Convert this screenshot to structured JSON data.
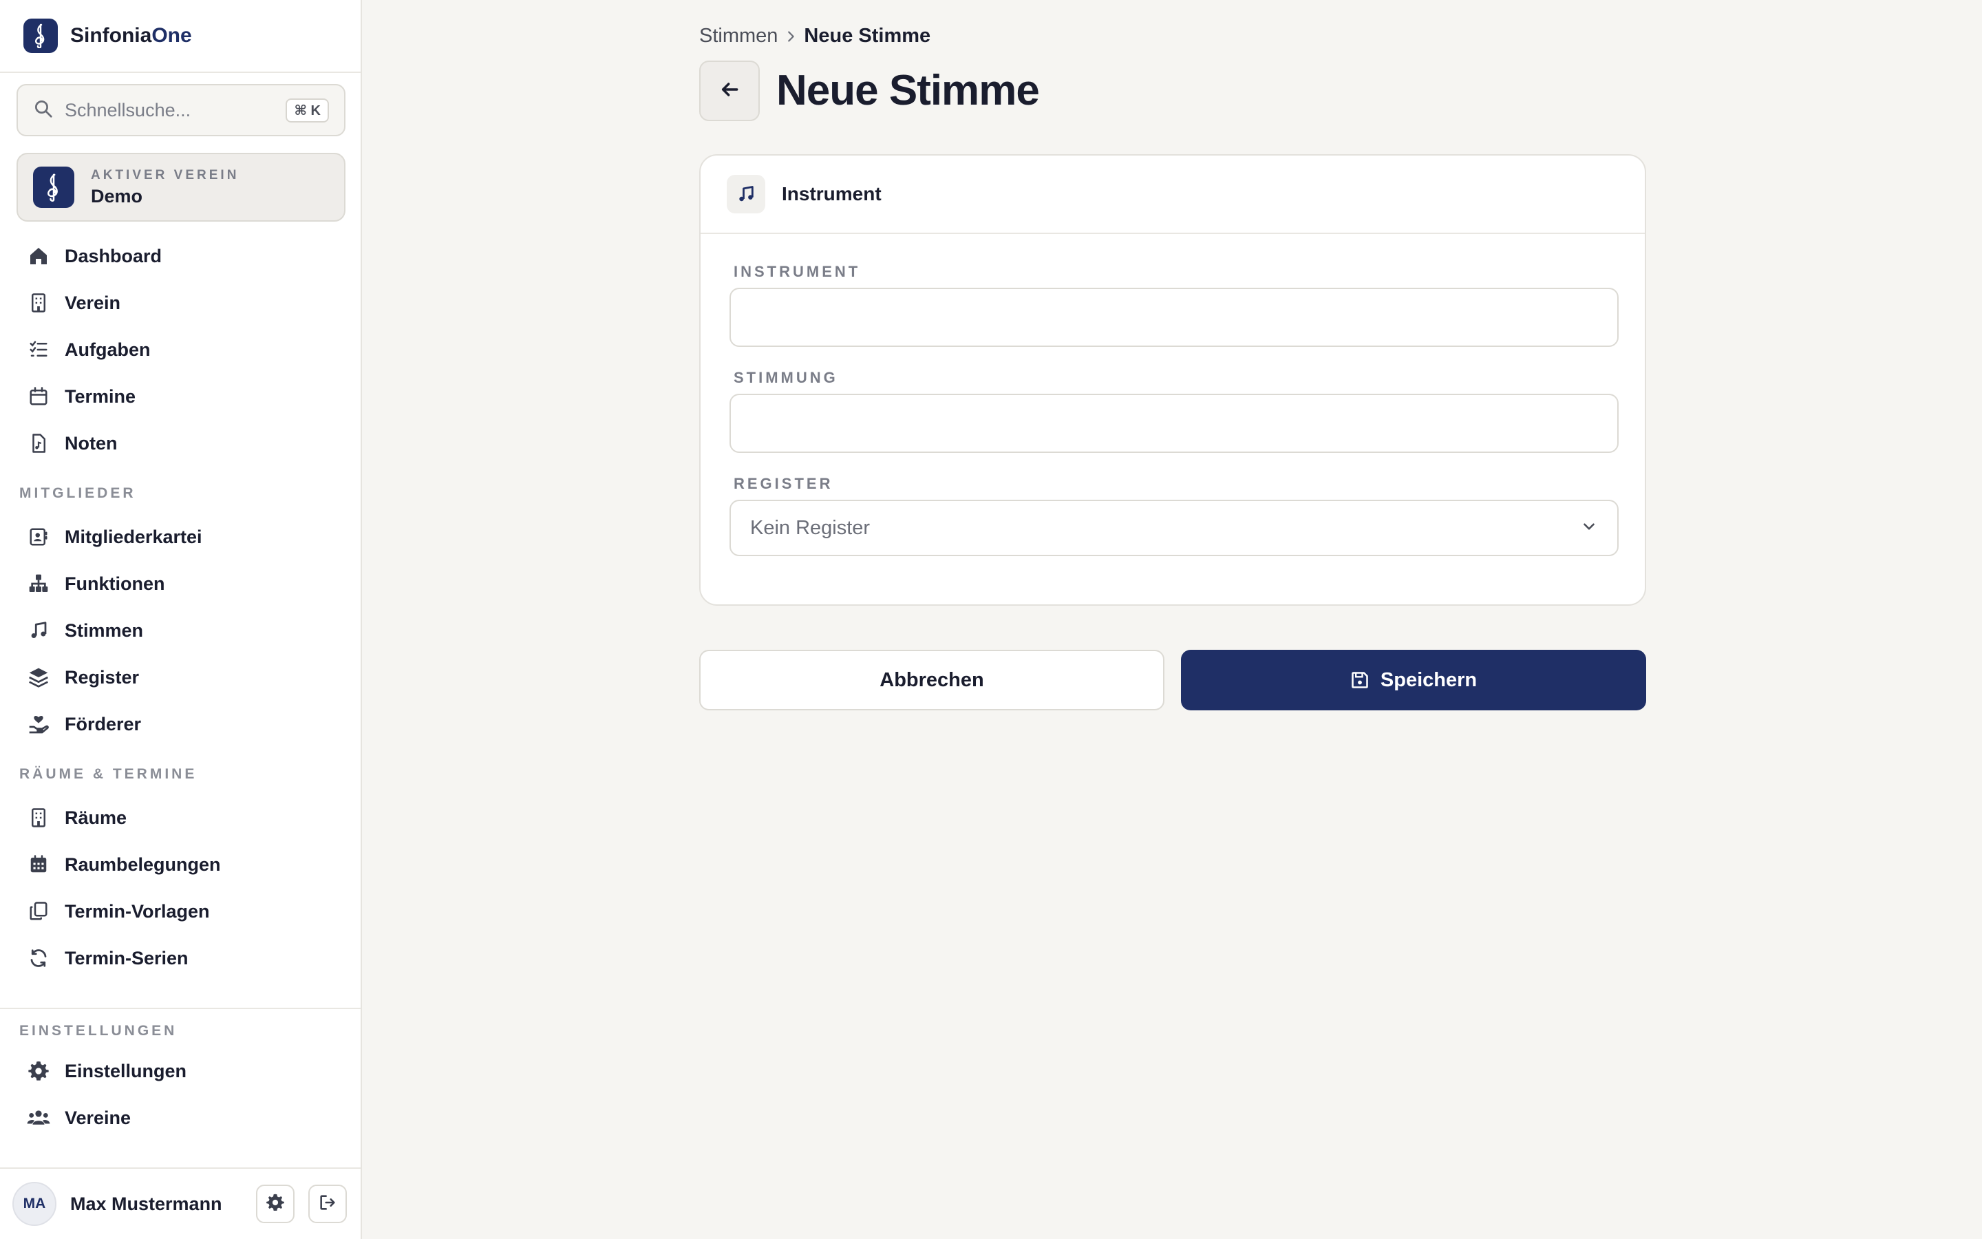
{
  "brand": {
    "name_part1": "Sinfonia",
    "name_part2": "One"
  },
  "search": {
    "placeholder": "Schnellsuche...",
    "shortcut": "⌘ K"
  },
  "club": {
    "kicker": "AKTIVER VEREIN",
    "name": "Demo"
  },
  "nav": {
    "main": [
      {
        "label": "Dashboard",
        "icon": "home-icon"
      },
      {
        "label": "Verein",
        "icon": "building-icon"
      },
      {
        "label": "Aufgaben",
        "icon": "checklist-icon"
      },
      {
        "label": "Termine",
        "icon": "calendar-icon"
      },
      {
        "label": "Noten",
        "icon": "sheet-music-icon"
      }
    ],
    "section_members": "MITGLIEDER",
    "members": [
      {
        "label": "Mitgliederkartei",
        "icon": "contact-card-icon"
      },
      {
        "label": "Funktionen",
        "icon": "hierarchy-icon"
      },
      {
        "label": "Stimmen",
        "icon": "music-note-icon"
      },
      {
        "label": "Register",
        "icon": "layers-icon"
      },
      {
        "label": "Förderer",
        "icon": "hand-heart-icon"
      }
    ],
    "section_rooms": "RÄUME & TERMINE",
    "rooms": [
      {
        "label": "Räume",
        "icon": "building-icon"
      },
      {
        "label": "Raumbelegungen",
        "icon": "calendar-grid-icon"
      },
      {
        "label": "Termin-Vorlagen",
        "icon": "copy-icon"
      },
      {
        "label": "Termin-Serien",
        "icon": "refresh-icon"
      }
    ],
    "section_settings": "EINSTELLUNGEN",
    "settings": [
      {
        "label": "Einstellungen",
        "icon": "gear-icon"
      },
      {
        "label": "Vereine",
        "icon": "users-icon"
      }
    ]
  },
  "user": {
    "initials": "MA",
    "name": "Max Mustermann"
  },
  "breadcrumb": {
    "parent": "Stimmen",
    "current": "Neue Stimme"
  },
  "page": {
    "title": "Neue Stimme"
  },
  "card": {
    "title": "Instrument",
    "fields": {
      "instrument_label": "INSTRUMENT",
      "instrument_value": "",
      "stimmung_label": "STIMMUNG",
      "stimmung_value": "",
      "register_label": "REGISTER",
      "register_value": "Kein Register"
    }
  },
  "actions": {
    "cancel": "Abbrechen",
    "save": "Speichern"
  },
  "colors": {
    "brand": "#1f2f66",
    "background": "#f6f5f2"
  }
}
